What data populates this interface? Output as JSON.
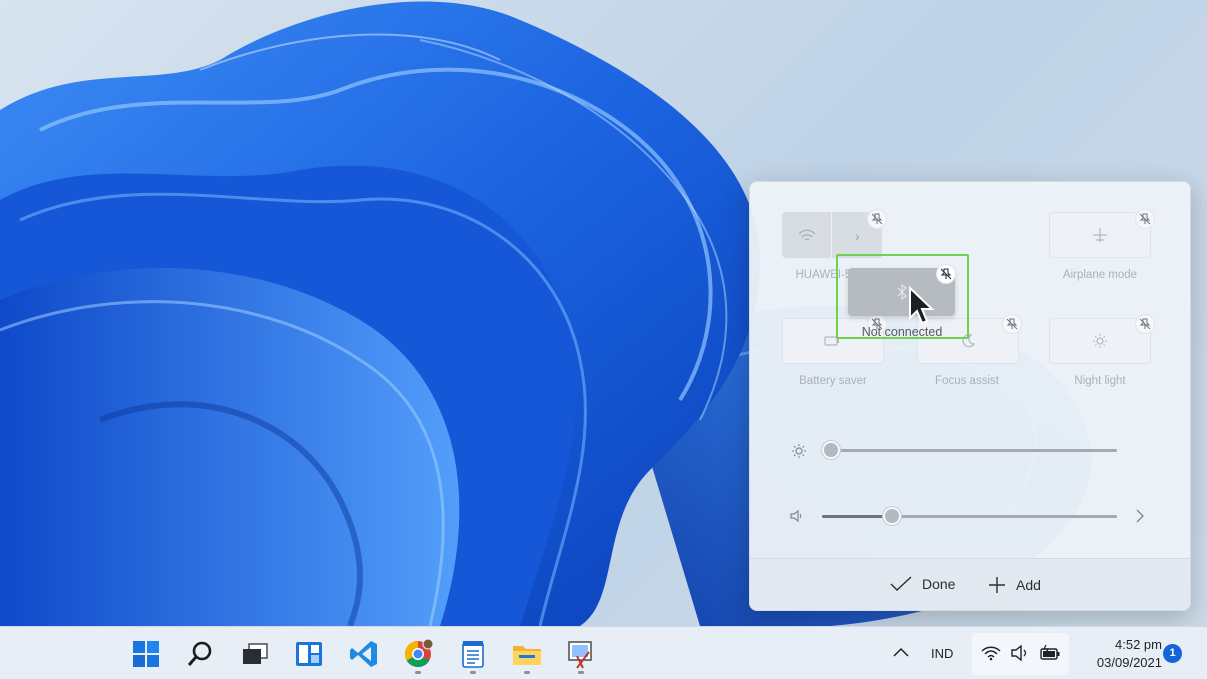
{
  "quick_settings": {
    "tiles": [
      {
        "id": "wifi",
        "label": "HUAWEI-588h",
        "icon": "wifi-icon"
      },
      {
        "id": "airplane",
        "label": "Airplane mode",
        "icon": "airplane-icon"
      },
      {
        "id": "battery",
        "label": "Battery saver",
        "icon": "battery-saver-icon"
      },
      {
        "id": "focus",
        "label": "Focus assist",
        "icon": "moon-icon"
      },
      {
        "id": "night",
        "label": "Night light",
        "icon": "sun-icon"
      }
    ],
    "dragging_tile": {
      "label": "Not connected",
      "icon": "bluetooth-icon"
    },
    "brightness": {
      "icon": "brightness-icon",
      "value": 0
    },
    "volume": {
      "icon": "speaker-icon",
      "value": 0.24
    },
    "footer": {
      "done_label": "Done",
      "add_label": "Add"
    }
  },
  "taskbar": {
    "apps": [
      "start-icon",
      "search-icon",
      "task-view-icon",
      "widgets-icon",
      "vscode-icon",
      "chrome-icon",
      "notepad-icon",
      "file-explorer-icon",
      "snipping-tool-icon"
    ],
    "tray": {
      "language": "IND"
    },
    "clock": {
      "time": "4:52 pm",
      "date": "03/09/2021"
    },
    "notification_count": "1"
  },
  "colors": {
    "accent": "#1565d8",
    "drag_outline": "#6fd24a",
    "wallpaper_blue": "#1f6fe8"
  }
}
